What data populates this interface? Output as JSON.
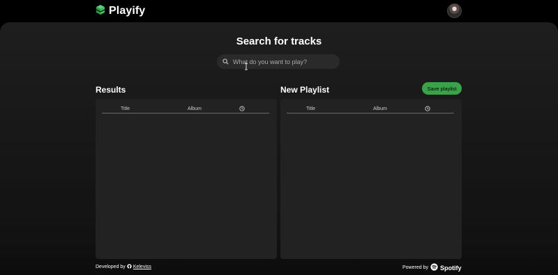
{
  "header": {
    "app_name": "Playify",
    "logo_icon": "cube-stack-icon",
    "avatar_icon": "user-avatar"
  },
  "search": {
    "title": "Search for tracks",
    "placeholder": "What do you want to play?",
    "icon": "search-icon"
  },
  "results": {
    "title": "Results",
    "columns": [
      "Title",
      "Album"
    ],
    "duration_icon": "clock-icon"
  },
  "playlist": {
    "title": "New Playlist",
    "save_label": "Save playlist",
    "columns": [
      "Title",
      "Album"
    ],
    "duration_icon": "clock-icon"
  },
  "footer": {
    "developed_by": "Developed by",
    "author": "Keleviss",
    "author_icon": "github-icon",
    "powered_by": "Powered by",
    "provider": "Spotify",
    "provider_icon": "spotify-icon"
  },
  "colors": {
    "accent": "#3aa34a",
    "background": "#000000",
    "panel": "#232223"
  }
}
